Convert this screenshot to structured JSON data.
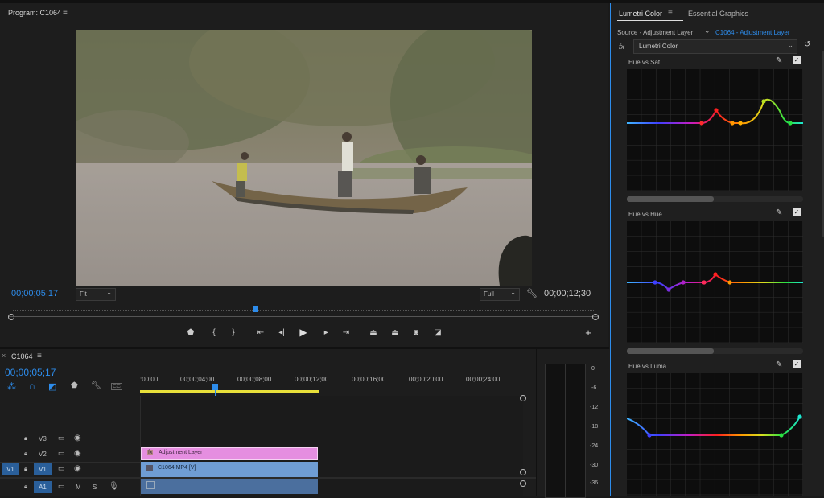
{
  "program_monitor": {
    "title": "Program: C1064",
    "current_time": "00;00;05;17",
    "fit_label": "Fit",
    "quality_label": "Full",
    "duration": "00;00;12;30"
  },
  "timeline": {
    "tab_title": "C1064",
    "current_time": "00;00;05;17",
    "ruler": [
      ":00;00",
      "00;00;04;00",
      "00;00;08;00",
      "00;00;12;00",
      "00;00;16;00",
      "00;00;20;00",
      "00;00;24;00"
    ],
    "tracks": [
      {
        "label": "V3",
        "source": ""
      },
      {
        "label": "V2",
        "source": ""
      },
      {
        "label": "V1",
        "source": "V1"
      },
      {
        "label": "A1",
        "source": "",
        "m": "M",
        "s": "S"
      }
    ],
    "clips": {
      "adjustment": "Adjustment Layer",
      "video": "C1064.MP4 [V]"
    },
    "cti_fraction": 0.41
  },
  "audio_meter": {
    "scale": [
      "0",
      "-6",
      "-12",
      "-18",
      "-24",
      "-30",
      "-36"
    ]
  },
  "lumetri": {
    "tabs": [
      "Lumetri Color",
      "Essential Graphics"
    ],
    "source_label": "Source - Adjustment Layer",
    "target_label": "C1064 - Adjustment Layer",
    "fx_label": "fx",
    "effect_name": "Lumetri Color",
    "curves": [
      {
        "title": "Hue vs Sat"
      },
      {
        "title": "Hue vs Hue"
      },
      {
        "title": "Hue vs Luma"
      }
    ]
  },
  "colors": {
    "accent": "#2d8ceb",
    "adjustment_clip": "#e58ee0",
    "video_clip": "#6f9dd4",
    "audio_clip": "#4b6f9e",
    "work_area": "#e8e03a"
  }
}
